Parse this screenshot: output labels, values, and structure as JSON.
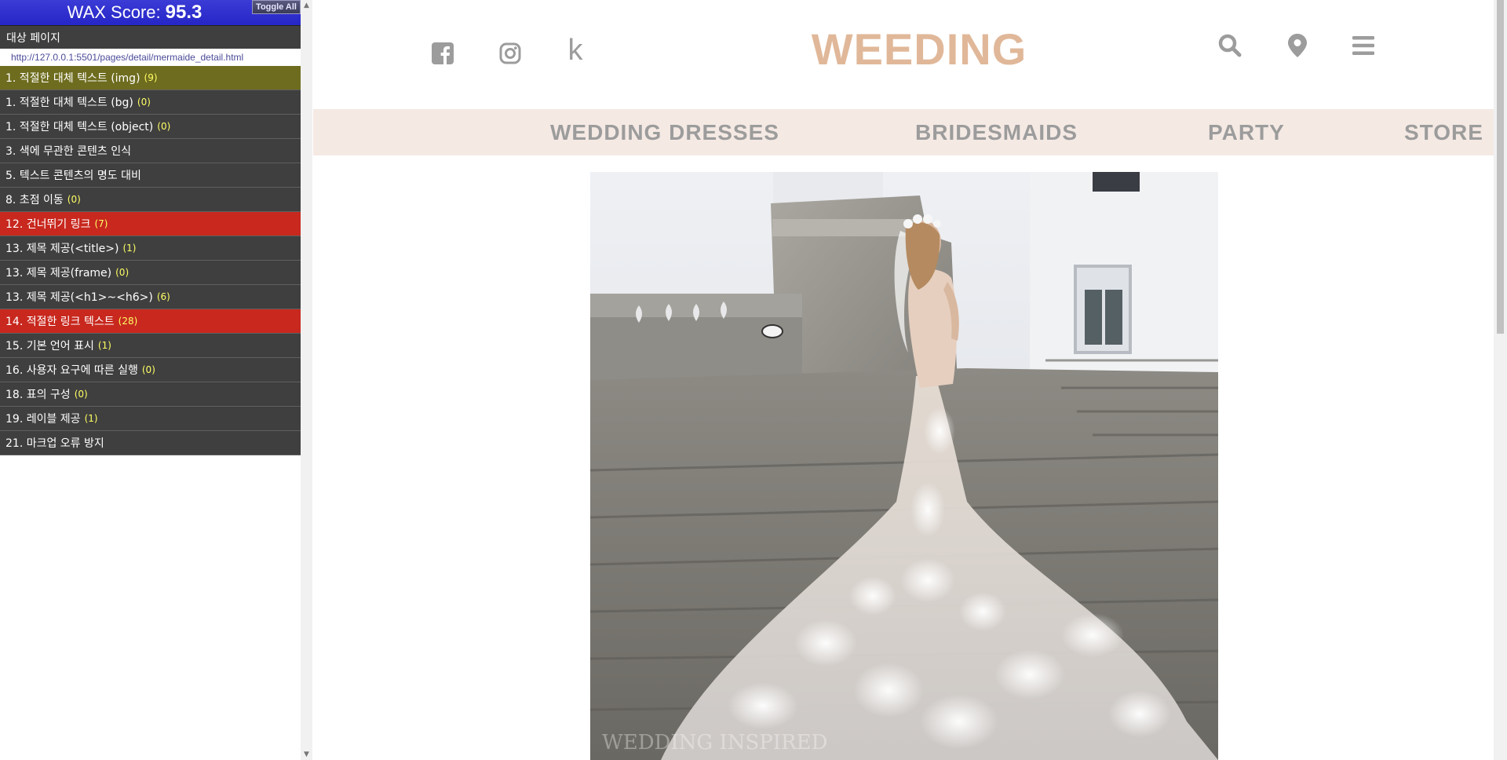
{
  "wax": {
    "score_label": "WAX Score:",
    "score_value": "95.3",
    "toggle_all": "Toggle All",
    "target_page_label": "대상 페이지",
    "target_url": "http://127.0.0.1:5501/pages/detail/mermaide_detail.html",
    "items": [
      {
        "label": "1. 적절한 대체 텍스트 (img)",
        "count": "(9)",
        "status": "warn"
      },
      {
        "label": "1. 적절한 대체 텍스트 (bg)",
        "count": "(0)",
        "status": "normal"
      },
      {
        "label": "1. 적절한 대체 텍스트 (object)",
        "count": "(0)",
        "status": "normal"
      },
      {
        "label": "3. 색에 무관한 콘텐츠 인식",
        "count": "",
        "status": "normal"
      },
      {
        "label": "5. 텍스트 콘텐츠의 명도 대비",
        "count": "",
        "status": "normal"
      },
      {
        "label": "8. 초점 이동",
        "count": "(0)",
        "status": "normal"
      },
      {
        "label": "12. 건너뛰기 링크",
        "count": "(7)",
        "status": "err"
      },
      {
        "label": "13. 제목 제공(<title>)",
        "count": "(1)",
        "status": "normal"
      },
      {
        "label": "13. 제목 제공(frame)",
        "count": "(0)",
        "status": "normal"
      },
      {
        "label": "13. 제목 제공(<h1>~<h6>)",
        "count": "(6)",
        "status": "normal"
      },
      {
        "label": "14. 적절한 링크 텍스트",
        "count": "(28)",
        "status": "err"
      },
      {
        "label": "15. 기본 언어 표시",
        "count": "(1)",
        "status": "normal"
      },
      {
        "label": "16. 사용자 요구에 따른 실행",
        "count": "(0)",
        "status": "normal"
      },
      {
        "label": "18. 표의 구성",
        "count": "(0)",
        "status": "normal"
      },
      {
        "label": "19. 레이블 제공",
        "count": "(1)",
        "status": "normal"
      },
      {
        "label": "21. 마크업 오류 방지",
        "count": "",
        "status": "normal"
      }
    ]
  },
  "site": {
    "logo": "WEEDING",
    "social_icons": [
      "facebook-icon",
      "instagram-icon",
      "kakaostory-icon"
    ],
    "kakao_glyph": "k",
    "header_icons": [
      "search-icon",
      "location-pin-icon",
      "menu-icon"
    ],
    "nav": [
      "WEDDING DRESSES",
      "BRIDESMAIDS",
      "PARTY",
      "STORE"
    ],
    "image_watermark": "WEDDING INSPIRED"
  },
  "colors": {
    "logo": "#e0b899",
    "nav_bg": "#f5e9e4",
    "nav_text": "#9c9c9c",
    "wax_header": "#2626c8",
    "wax_item": "#3f3f3f",
    "wax_warn": "#6e6c1e",
    "wax_error": "#c8281e"
  }
}
